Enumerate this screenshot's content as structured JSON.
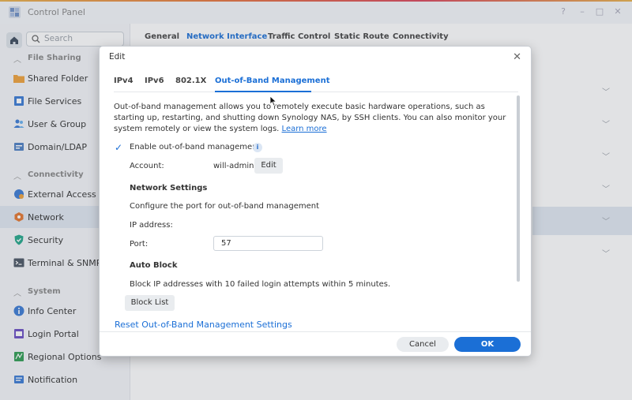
{
  "window": {
    "title": "Control Panel"
  },
  "sidebar": {
    "search_placeholder": "Search",
    "sections": [
      {
        "label": "File Sharing",
        "items": [
          {
            "label": "Shared Folder",
            "icon": "folder-icon"
          },
          {
            "label": "File Services",
            "icon": "file-services-icon"
          },
          {
            "label": "User & Group",
            "icon": "user-group-icon"
          },
          {
            "label": "Domain/LDAP",
            "icon": "domain-icon"
          }
        ]
      },
      {
        "label": "Connectivity",
        "items": [
          {
            "label": "External Access",
            "icon": "external-access-icon"
          },
          {
            "label": "Network",
            "icon": "network-icon",
            "active": true
          },
          {
            "label": "Security",
            "icon": "security-shield-icon"
          },
          {
            "label": "Terminal & SNMP",
            "icon": "terminal-icon"
          }
        ]
      },
      {
        "label": "System",
        "items": [
          {
            "label": "Info Center",
            "icon": "info-icon"
          },
          {
            "label": "Login Portal",
            "icon": "login-portal-icon"
          },
          {
            "label": "Regional Options",
            "icon": "regional-options-icon"
          },
          {
            "label": "Notification",
            "icon": "notification-icon"
          }
        ]
      }
    ]
  },
  "main": {
    "tabs": [
      "General",
      "Network Interface",
      "Traffic Control",
      "Static Route",
      "Connectivity"
    ],
    "active_tab": "Network Interface"
  },
  "modal": {
    "title": "Edit",
    "tabs": [
      "IPv4",
      "IPv6",
      "802.1X",
      "Out-of-Band Management"
    ],
    "active_tab": "Out-of-Band Management",
    "description": "Out-of-band management allows you to remotely execute basic hardware operations, such as starting up, restarting, and shutting down Synology NAS, by SSH clients. You can also monitor your system remotely or view the system logs.",
    "learn_more": "Learn more",
    "enable_label": "Enable out-of-band management",
    "enable_checked": true,
    "account_label": "Account:",
    "account_value": "will-admin",
    "edit_button": "Edit",
    "network_settings_header": "Network Settings",
    "network_settings_desc": "Configure the port for out-of-band management",
    "ip_label": "IP address:",
    "port_label": "Port:",
    "port_value": "57",
    "auto_block_header": "Auto Block",
    "auto_block_desc": "Block IP addresses with 10 failed login attempts within 5 minutes.",
    "block_list_button": "Block List",
    "reset_link": "Reset Out-of-Band Management Settings",
    "cancel_button": "Cancel",
    "ok_button": "OK"
  },
  "colors": {
    "accent": "#1b6fd6",
    "sidebar_bg": "#f4f6f9",
    "active_bg": "#e1e8f2"
  }
}
